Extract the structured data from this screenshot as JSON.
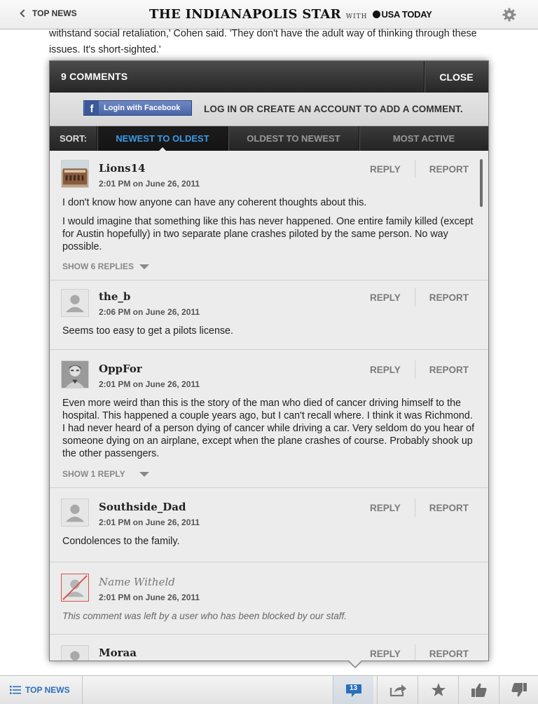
{
  "topbar": {
    "back_label": "TOP NEWS",
    "brand_main": "THE INDIANAPOLIS STAR",
    "brand_with": "WITH",
    "brand_partner": "USA TODAY",
    "settings_icon": "gear-icon"
  },
  "article": {
    "text": "withstand social retaliation,' Cohen said. 'They don't have the adult way of thinking through these issues. It's short-sighted.'"
  },
  "comments_panel": {
    "count_label": "9 COMMENTS",
    "close_label": "CLOSE",
    "facebook_button_label": "Login with Facebook",
    "login_prompt": "LOG IN OR CREATE AN ACCOUNT TO ADD A COMMENT.",
    "sort_label": "SORT:",
    "sort_tabs": [
      {
        "label": "NEWEST TO OLDEST",
        "active": true
      },
      {
        "label": "OLDEST TO NEWEST",
        "active": false
      },
      {
        "label": "MOST ACTIVE",
        "active": false
      }
    ],
    "reply_label": "REPLY",
    "report_label": "REPORT",
    "comments": [
      {
        "user": "Lions14",
        "time": "2:01 PM on June 26, 2011",
        "paragraphs": [
          "I don't know how anyone can have any coherent thoughts about this.",
          "I would imagine that something like this has never happened. One entire family killed (except for Austin hopefully) in two separate plane crashes piloted by the same person. No way possible."
        ],
        "replies_label": "SHOW 6 REPLIES"
      },
      {
        "user": "the_b",
        "time": "2:06 PM on June 26, 2011",
        "paragraphs": [
          "Seems too easy to get a pilots license."
        ]
      },
      {
        "user": "OppFor",
        "time": "2:01 PM on June 26, 2011",
        "paragraphs": [
          "Even more weird than this is the story of the man who died of cancer driving himself to the hospital. This happened a couple years ago, but I can't recall where. I think it was Richmond. I had never heard of a person dying of cancer while driving a car. Very seldom do you hear of someone dying on an airplane, except when the plane crashes of course. Probably shook up the other passengers."
        ],
        "replies_label": "SHOW 1 REPLY"
      },
      {
        "user": "Southside_Dad",
        "time": "2:01 PM on June 26, 2011",
        "paragraphs": [
          "Condolences to the family."
        ]
      },
      {
        "user": "Name Witheld",
        "time": "2:01 PM on June 26, 2011",
        "blocked_text": "This comment was left by a user who has been blocked by our staff."
      },
      {
        "user": "Moraa"
      }
    ]
  },
  "bottombar": {
    "top_news_label": "TOP NEWS",
    "comment_count": "13"
  },
  "colors": {
    "accent_blue": "#3a9ae8",
    "link_blue": "#2a6fbf",
    "facebook_blue": "#3b5998",
    "blocked_red": "#d9534f"
  }
}
